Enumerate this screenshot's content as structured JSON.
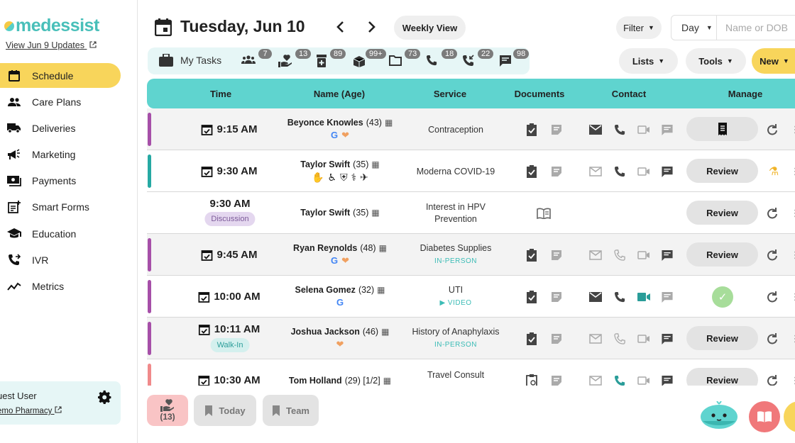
{
  "brand": {
    "name": "medessist",
    "updates_link": "View Jun 9 Updates"
  },
  "sidebar": {
    "items": [
      {
        "label": "Schedule",
        "icon": "calendar-icon",
        "active": true
      },
      {
        "label": "Care Plans",
        "icon": "people-icon"
      },
      {
        "label": "Deliveries",
        "icon": "truck-icon"
      },
      {
        "label": "Marketing",
        "icon": "megaphone-icon"
      },
      {
        "label": "Payments",
        "icon": "cash-icon"
      },
      {
        "label": "Smart Forms",
        "icon": "form-icon"
      },
      {
        "label": "Education",
        "icon": "graduation-cap-icon"
      },
      {
        "label": "IVR",
        "icon": "phone-forward-icon"
      },
      {
        "label": "Metrics",
        "icon": "chart-line-icon"
      }
    ],
    "user": {
      "name": "uest User",
      "pharmacy": "emo Pharmacy"
    }
  },
  "header": {
    "date": "Tuesday, Jun 10",
    "view_button": "Weekly View",
    "filter": "Filter",
    "day_select": "Day",
    "search_placeholder": "Name or DOB"
  },
  "taskbar": {
    "my_tasks": "My Tasks",
    "badges": [
      "7",
      "13",
      "89",
      "99+",
      "73",
      "18",
      "22",
      "98"
    ]
  },
  "toolbar": {
    "lists": "Lists",
    "tools": "Tools",
    "new": "New"
  },
  "table": {
    "headers": [
      "Time",
      "Name (Age)",
      "Service",
      "Documents",
      "Contact",
      "Manage"
    ],
    "rows": [
      {
        "time": "9:15 AM",
        "name": "Beyonce Knowles",
        "age": "(43)",
        "service": "Contraception",
        "service_sub": "",
        "manage": "",
        "bar_color": "#a64fa8"
      },
      {
        "time": "9:30 AM",
        "name": "Taylor Swift",
        "age": "(35)",
        "service": "Moderna COVID-19",
        "service_sub": "",
        "manage": "Review",
        "bar_color": "#26a9a3"
      },
      {
        "time": "9:30 AM",
        "tag": "Discussion",
        "name": "Taylor Swift",
        "age": "(35)",
        "service": "Interest in HPV",
        "service_line2": "Prevention",
        "manage": "Review",
        "bar_color": ""
      },
      {
        "time": "9:45 AM",
        "name": "Ryan Reynolds",
        "age": "(48)",
        "service": "Diabetes Supplies",
        "service_sub": "IN-PERSON",
        "manage": "Review",
        "bar_color": "#a64fa8"
      },
      {
        "time": "10:00 AM",
        "name": "Selena Gomez",
        "age": "(32)",
        "service": "UTI",
        "service_sub": "VIDEO",
        "manage": "",
        "bar_color": "#a64fa8"
      },
      {
        "time": "10:11 AM",
        "tag": "Walk-In",
        "name": "Joshua Jackson",
        "age": "(46)",
        "service": "History of Anaphylaxis",
        "service_sub": "IN-PERSON",
        "manage": "Review",
        "bar_color": "#a64fa8"
      },
      {
        "time": "10:30 AM",
        "name": "Tom Holland",
        "age": "(29) [1/2]",
        "service": "Travel Consult",
        "service_sub": "",
        "manage": "Review",
        "bar_color": "#f08a8b"
      }
    ]
  },
  "bottom": {
    "count": "(13)",
    "today": "Today",
    "team": "Team"
  }
}
